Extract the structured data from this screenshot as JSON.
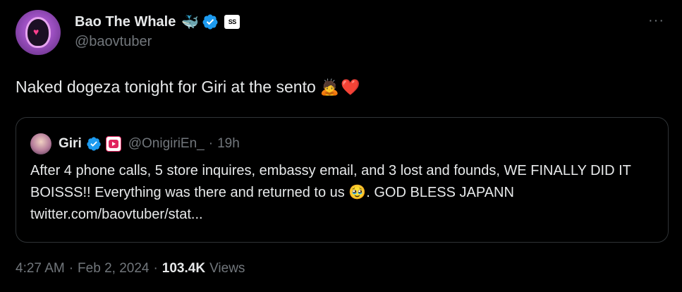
{
  "author": {
    "display_name": "Bao The Whale",
    "handle": "@baovtuber",
    "badge_text": "SS"
  },
  "post": {
    "text": "Naked dogeza tonight for Giri at the sento"
  },
  "quoted": {
    "name": "Giri",
    "handle": "@OnigiriEn_",
    "separator": "·",
    "time": "19h",
    "text": "After 4 phone calls, 5 store inquires, embassy email, and 3 lost and founds, WE FINALLY DID IT BOISSS!! Everything was there and returned to us 🥹. GOD BLESS JAPANN twitter.com/baovtuber/stat..."
  },
  "meta": {
    "time": "4:27 AM",
    "sep1": "·",
    "date": "Feb 2, 2024",
    "sep2": "·",
    "views_count": "103.4K",
    "views_label": "Views"
  },
  "colors": {
    "background": "#000000",
    "text": "#e7e9ea",
    "muted": "#71767b",
    "verified": "#1d9bf0",
    "border": "#2f3336"
  }
}
